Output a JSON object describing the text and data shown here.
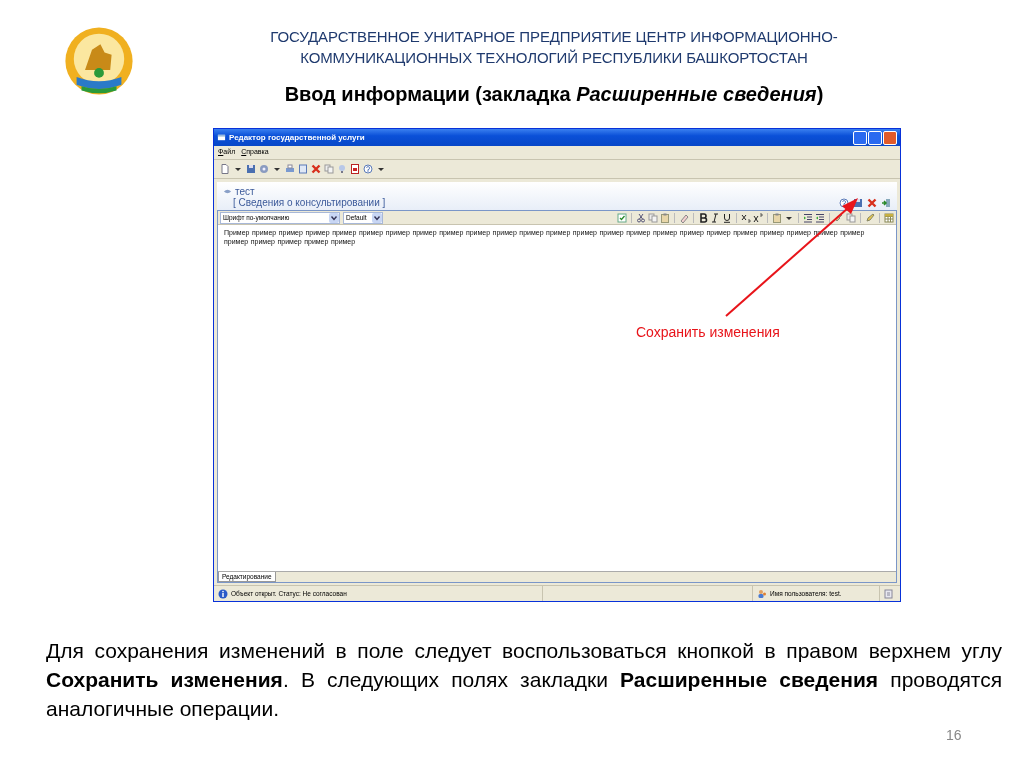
{
  "header": {
    "organization_lines": [
      "ГОСУДАРСТВЕННОЕ УНИТАРНОЕ ПРЕДПРИЯТИЕ ЦЕНТР ИНФОРМАЦИОННО-",
      "КОММУНИКАЦИОННЫХ ТЕХНОЛОГИЙ РЕСПУБЛИКИ БАШКОРТОСТАН"
    ],
    "title": "Ввод информации (закладка *Расширенные сведения*)"
  },
  "window": {
    "title": "Редактор государственной услуги",
    "menu": [
      {
        "label": "Файл"
      },
      {
        "label": "Справка"
      }
    ],
    "document": {
      "name": "тест",
      "subtitle": "[ Сведения о консультировании ]"
    },
    "editor": {
      "font": "Шрифт по-умолчанию",
      "style": "Default",
      "text": "Пример пример пример пример пример пример пример пример пример пример пример пример пример пример пример пример пример пример пример пример пример пример пример пример пример пример пример пример пример",
      "tabs": [
        {
          "label": "Редактирование",
          "selected": true
        }
      ]
    },
    "status_bar": {
      "message": "Объект открыт. Статус: Не согласован",
      "user": "Имя пользователя: test."
    }
  },
  "annotation": {
    "label": "Сохранить изменения"
  },
  "caption": "Для сохранения изменений в поле следует воспользоваться кнопкой в правом верхнем углу **Сохранить изменения**. В следующих полях закладки **Расширенные сведения** проводятся аналогичные операции.",
  "page_number": "16"
}
